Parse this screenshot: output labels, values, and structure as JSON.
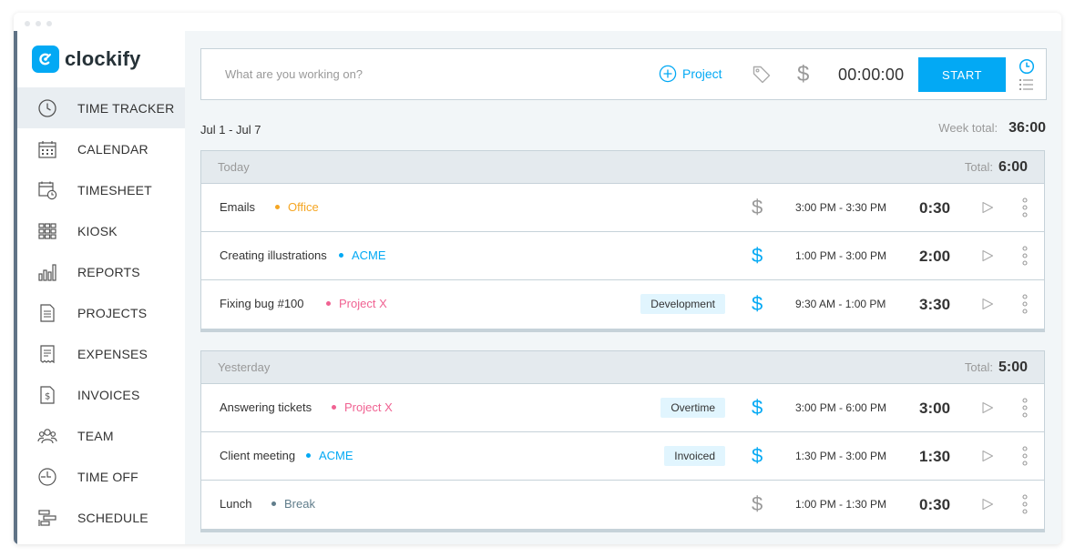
{
  "app": {
    "logo_text": "clockify"
  },
  "sidebar": {
    "items": [
      {
        "label": "TIME TRACKER",
        "icon": "clock-icon",
        "active": true
      },
      {
        "label": "CALENDAR",
        "icon": "calendar-icon",
        "active": false
      },
      {
        "label": "TIMESHEET",
        "icon": "timesheet-icon",
        "active": false
      },
      {
        "label": "KIOSK",
        "icon": "kiosk-icon",
        "active": false
      },
      {
        "label": "REPORTS",
        "icon": "bar-chart-icon",
        "active": false
      },
      {
        "label": "PROJECTS",
        "icon": "document-icon",
        "active": false
      },
      {
        "label": "EXPENSES",
        "icon": "receipt-icon",
        "active": false
      },
      {
        "label": "INVOICES",
        "icon": "invoice-icon",
        "active": false
      },
      {
        "label": "TEAM",
        "icon": "team-icon",
        "active": false
      },
      {
        "label": "TIME OFF",
        "icon": "time-off-icon",
        "active": false
      },
      {
        "label": "SCHEDULE",
        "icon": "schedule-icon",
        "active": false
      }
    ]
  },
  "tracker": {
    "placeholder": "What are you working on?",
    "project_label": "Project",
    "timer": "00:00:00",
    "start_label": "START"
  },
  "week": {
    "range": "Jul 1 - Jul 7",
    "total_label": "Week total:",
    "total": "36:00"
  },
  "groups": [
    {
      "title": "Today",
      "total_label": "Total:",
      "total": "6:00",
      "entries": [
        {
          "description": "Emails",
          "project": "Office",
          "project_color": "#f5a623",
          "tag": "",
          "billable": false,
          "time_range": "3:00 PM - 3:30 PM",
          "duration": "0:30"
        },
        {
          "description": "Creating illustrations",
          "project": "ACME",
          "project_color": "#03a9f4",
          "tag": "",
          "billable": true,
          "time_range": "1:00 PM - 3:00 PM",
          "duration": "2:00"
        },
        {
          "description": "Fixing bug #100",
          "project": "Project X",
          "project_color": "#f06292",
          "tag": "Development",
          "billable": true,
          "time_range": "9:30 AM - 1:00 PM",
          "duration": "3:30"
        }
      ]
    },
    {
      "title": "Yesterday",
      "total_label": "Total:",
      "total": "5:00",
      "entries": [
        {
          "description": "Answering tickets",
          "project": "Project X",
          "project_color": "#f06292",
          "tag": "Overtime",
          "billable": true,
          "time_range": "3:00 PM - 6:00 PM",
          "duration": "3:00"
        },
        {
          "description": "Client meeting",
          "project": "ACME",
          "project_color": "#03a9f4",
          "tag": "Invoiced",
          "billable": true,
          "time_range": "1:30 PM - 3:00 PM",
          "duration": "1:30"
        },
        {
          "description": "Lunch",
          "project": "Break",
          "project_color": "#607d8b",
          "tag": "",
          "billable": false,
          "time_range": "1:00 PM - 1:30 PM",
          "duration": "0:30"
        }
      ]
    }
  ],
  "colors": {
    "accent": "#03a9f4",
    "billable_on": "#03a9f4",
    "billable_off": "#999999",
    "tag_bg": "#e1f5fe"
  }
}
